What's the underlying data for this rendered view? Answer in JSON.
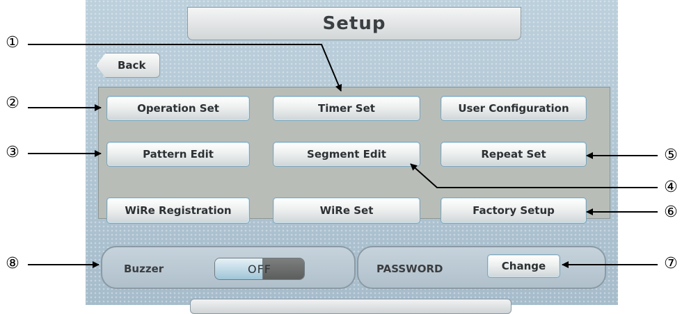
{
  "title": "Setup",
  "back_label": "Back",
  "buttons": {
    "operation_set": "Operation Set",
    "timer_set": "Timer Set",
    "user_configuration": "User Configuration",
    "pattern_edit": "Pattern Edit",
    "segment_edit": "Segment Edit",
    "repeat_set": "Repeat Set",
    "wire_registration": "WiRe Registration",
    "wire_set": "WiRe Set",
    "factory_setup": "Factory Setup"
  },
  "buzzer": {
    "label": "Buzzer",
    "state": "OFF"
  },
  "password": {
    "label": "PASSWORD",
    "change_label": "Change"
  },
  "callouts": [
    "①",
    "②",
    "③",
    "④",
    "⑤",
    "⑥",
    "⑦",
    "⑧"
  ]
}
